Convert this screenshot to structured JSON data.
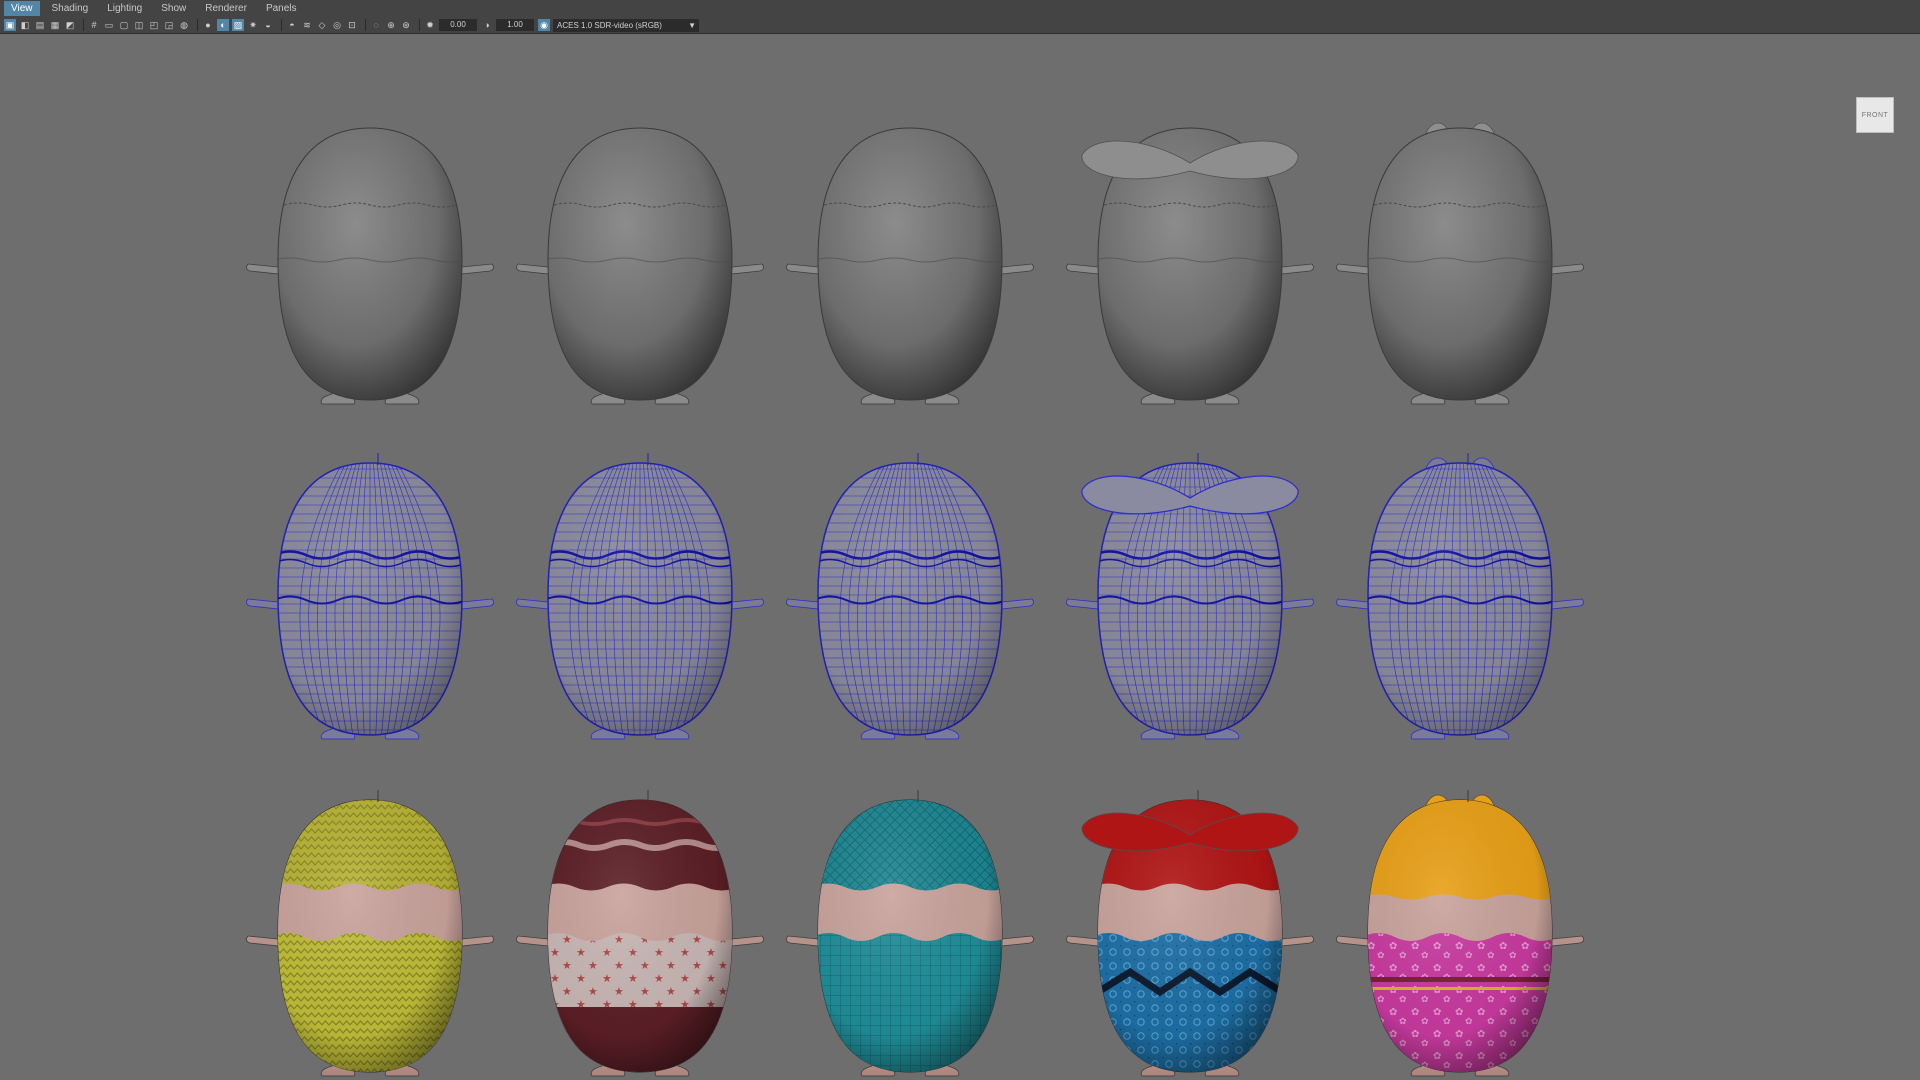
{
  "menu": {
    "items": [
      "View",
      "Shading",
      "Lighting",
      "Show",
      "Renderer",
      "Panels"
    ],
    "active": "View"
  },
  "toolbar": {
    "exposure_value": "0.00",
    "gamma_value": "1.00",
    "color_space": "ACES 1.0 SDR-video (sRGB)",
    "icons": [
      "select-camera-icon",
      "camera-attributes-icon",
      "bookmarks-icon",
      "image-plane-icon",
      "view-transform-icon",
      "grid-icon",
      "film-gate-icon",
      "resolution-gate-icon",
      "gate-mask-icon",
      "field-chart-icon",
      "safe-action-icon",
      "wireframe-icon",
      "smooth-shade-icon",
      "default-material-icon",
      "textured-icon",
      "use-all-lights-icon",
      "shadows-icon",
      "screen-space-ao-icon",
      "motion-blur-icon",
      "anti-aliasing-icon",
      "depth-of-field-icon",
      "isolate-select-icon",
      "xray-icon",
      "xray-joints-icon",
      "xray-components-icon",
      "exposure-icon",
      "gamma-icon",
      "color-management-icon"
    ]
  },
  "view_cube": {
    "label": "FRONT"
  },
  "viewport": {
    "background": "#6e6e6e",
    "rows": [
      "smooth-shaded",
      "wireframe",
      "textured"
    ],
    "characters": [
      {
        "name": "plain-chick",
        "top": "plain",
        "base_color": "#c0bf3a",
        "pattern": "zigzag"
      },
      {
        "name": "striped-chick",
        "top": "plain",
        "base_color": "#5c1f26",
        "pattern": "stars"
      },
      {
        "name": "teal-chick",
        "top": "plain",
        "base_color": "#1f8f9a",
        "pattern": "grid"
      },
      {
        "name": "mustache-chick",
        "top": "mustache",
        "base_color": "#1d6fa6",
        "pattern": "zigzag-band",
        "accent_color": "#b01515"
      },
      {
        "name": "bunny-chick",
        "top": "bunny-ears",
        "base_color": "#c93aa0",
        "pattern": "flowers",
        "accent_color": "#e8a017"
      }
    ]
  }
}
